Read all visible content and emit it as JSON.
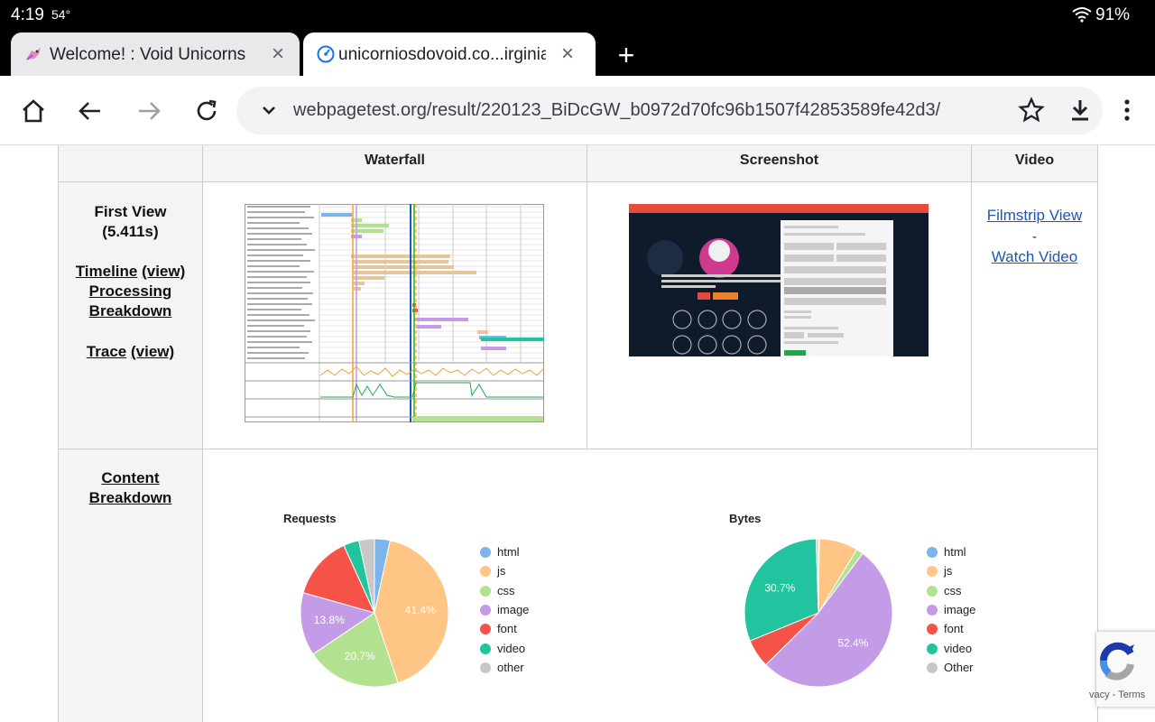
{
  "status_bar": {
    "time": "4:19",
    "temp": "54°",
    "battery": "91%"
  },
  "tabs": [
    {
      "title": "Welcome! : Void Unicorns",
      "active": false
    },
    {
      "title": "unicorniosdovoid.co...irginia U",
      "active": true
    }
  ],
  "toolbar": {
    "url": "webpagetest.org/result/220123_BiDcGW_b0972d70fc96b1507f42853589fe42d3/"
  },
  "table": {
    "headers": {
      "waterfall": "Waterfall",
      "screenshot": "Screenshot",
      "video": "Video"
    },
    "first_view": {
      "title": "First View",
      "time": "(5.411s)",
      "timeline": "Timeline",
      "timeline_view": "(view)",
      "processing": "Processing",
      "breakdown": "Breakdown",
      "trace": "Trace",
      "trace_view": "(view)"
    },
    "video": {
      "filmstrip": "Filmstrip View",
      "dash": "-",
      "watch": "Watch Video"
    },
    "content_breakdown": {
      "line1": "Content",
      "line2": "Breakdown"
    }
  },
  "recaptcha": {
    "text": "vacy - Terms"
  },
  "chart_data": [
    {
      "type": "pie",
      "title": "Requests",
      "labels": [
        "html",
        "js",
        "css",
        "image",
        "font",
        "video",
        "other"
      ],
      "values": [
        3.4,
        41.4,
        20.7,
        13.8,
        13.8,
        3.4,
        3.4
      ],
      "colors": [
        "#7cb5ec",
        "#ffc585",
        "#b2e28f",
        "#c39be6",
        "#f55347",
        "#22c4a0",
        "#c8c8c8"
      ],
      "data_labels": [
        "",
        "41.4%",
        "20.7%",
        "13.8%",
        "",
        "",
        ""
      ],
      "legend_position": "right"
    },
    {
      "type": "pie",
      "title": "Bytes",
      "labels": [
        "html",
        "js",
        "css",
        "image",
        "font",
        "video",
        "Other"
      ],
      "values": [
        0.2,
        8.5,
        1.5,
        52.4,
        6.2,
        30.7,
        0.5
      ],
      "colors": [
        "#7cb5ec",
        "#ffc585",
        "#b2e28f",
        "#c39be6",
        "#f55347",
        "#22c4a0",
        "#c8c8c8"
      ],
      "data_labels": [
        "",
        "",
        "",
        "52.4%",
        "",
        "30.7%",
        ""
      ],
      "legend_position": "right"
    }
  ]
}
